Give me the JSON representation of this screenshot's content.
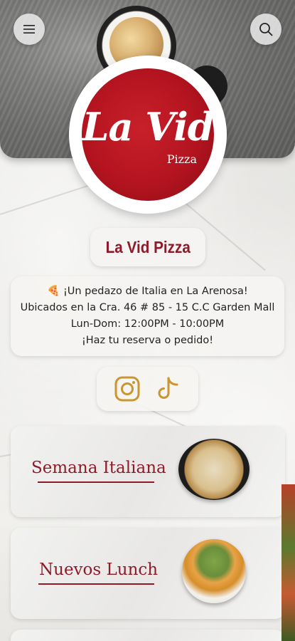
{
  "restaurant": {
    "name": "La Vid Pizza",
    "logo_text": "La Vid",
    "logo_subtext": "Pizza"
  },
  "header": {
    "menu_icon": "hamburger-menu-icon",
    "search_icon": "search-icon"
  },
  "description": {
    "lines": [
      "🍕 ¡Un pedazo de Italia en La Arenosa!",
      "Ubicados en la Cra. 46 # 85 - 15 C.C Garden Mall",
      "Lun-Dom: 12:00PM - 10:00PM",
      "¡Haz tu reserva o pedido!"
    ]
  },
  "social": {
    "instagram_icon": "instagram-icon",
    "tiktok_icon": "tiktok-icon",
    "icon_color": "#c9962f"
  },
  "promos": [
    {
      "label": "Semana Italiana"
    },
    {
      "label": "Nuevos Lunch"
    }
  ],
  "colors": {
    "brand_red": "#8e1b2a",
    "logo_red": "#b3141f"
  }
}
